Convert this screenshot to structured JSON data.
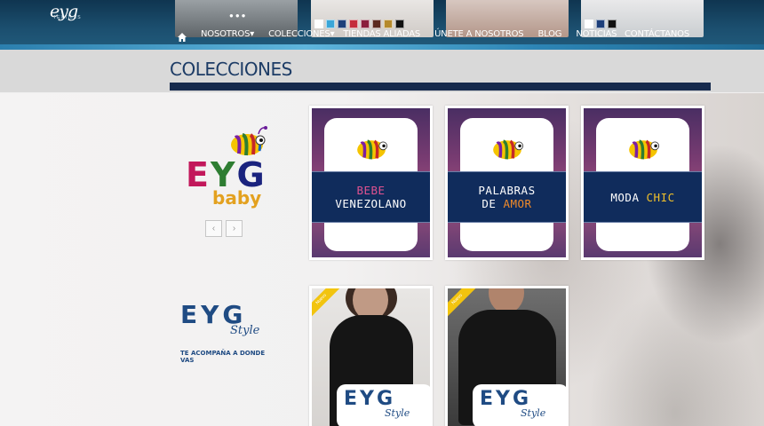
{
  "header": {
    "logo_text": "eyg",
    "logo_sub": "TEXTILES",
    "nav": [
      "NOSOTROS",
      "COLECCIONES",
      "TIENDAS ALIADAS",
      "ÚNETE A NOSOTROS",
      "BLOG",
      "NOTICIAS"
    ],
    "contact": "CONTÁCTANOS",
    "swatch_colors_1": [
      "#ffffff",
      "#3aa6d8",
      "#1d3f7a",
      "#c42d3b",
      "#8a1e3c",
      "#5b2a1f",
      "#b58a2d",
      "#111111"
    ],
    "swatch_colors_2": [
      "#ffffff",
      "#1d3f7a",
      "#111111"
    ]
  },
  "page": {
    "title": "COLECCIONES"
  },
  "brands": {
    "baby": {
      "letters": [
        "E",
        "Y",
        "G"
      ],
      "word": "baby",
      "letter_colors": [
        "#c2185b",
        "#2e7d32",
        "#1a237e"
      ]
    },
    "style": {
      "letters": "EYG",
      "script": "Style",
      "tagline": "TE ACOMPAÑA A DONDE VAS"
    }
  },
  "carousel": {
    "prev_icon": "chevron-left-icon",
    "next_icon": "chevron-right-icon",
    "prev": "‹",
    "next": "›"
  },
  "collections": [
    {
      "name": "BEBE VENEZOLANO",
      "line1": "BEBE",
      "line2": "VENEZOLANO"
    },
    {
      "name": "PALABRAS DE AMOR",
      "line1": "PALABRAS",
      "line2a": "DE ",
      "line2b": "AMOR"
    },
    {
      "name": "MODA CHIC",
      "line1a": "MODA ",
      "line1b": "CHIC"
    }
  ],
  "style_products": [
    {
      "badge": "Nuevo",
      "logo": "EYG",
      "script": "Style"
    },
    {
      "badge": "Nuevo",
      "logo": "EYG",
      "script": "Style"
    }
  ]
}
